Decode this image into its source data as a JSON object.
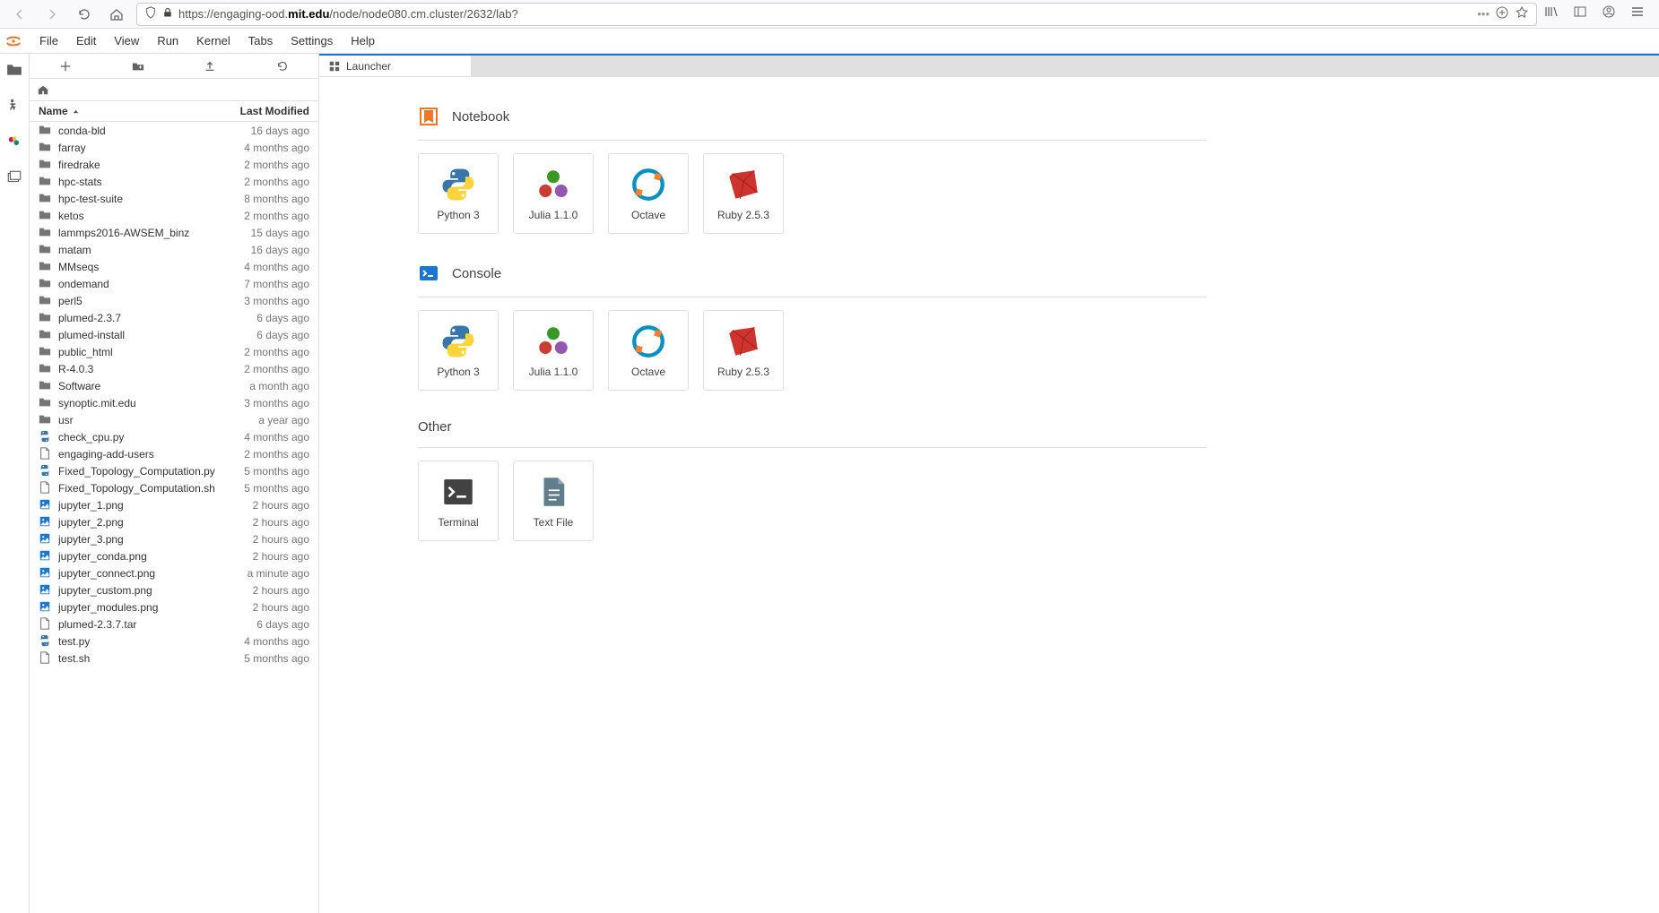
{
  "browser": {
    "url_prefix": "https://engaging-ood.",
    "url_domain": "mit.edu",
    "url_suffix": "/node/node080.cm.cluster/2632/lab?"
  },
  "menubar": [
    "File",
    "Edit",
    "View",
    "Run",
    "Kernel",
    "Tabs",
    "Settings",
    "Help"
  ],
  "filebrowser": {
    "header_name": "Name",
    "header_modified": "Last Modified",
    "files": [
      {
        "name": "conda-bld",
        "type": "folder",
        "modified": "16 days ago"
      },
      {
        "name": "farray",
        "type": "folder",
        "modified": "4 months ago"
      },
      {
        "name": "firedrake",
        "type": "folder",
        "modified": "2 months ago"
      },
      {
        "name": "hpc-stats",
        "type": "folder",
        "modified": "2 months ago"
      },
      {
        "name": "hpc-test-suite",
        "type": "folder",
        "modified": "8 months ago"
      },
      {
        "name": "ketos",
        "type": "folder",
        "modified": "2 months ago"
      },
      {
        "name": "lammps2016-AWSEM_binz",
        "type": "folder",
        "modified": "15 days ago"
      },
      {
        "name": "matam",
        "type": "folder",
        "modified": "16 days ago"
      },
      {
        "name": "MMseqs",
        "type": "folder",
        "modified": "4 months ago"
      },
      {
        "name": "ondemand",
        "type": "folder",
        "modified": "7 months ago"
      },
      {
        "name": "perl5",
        "type": "folder",
        "modified": "3 months ago"
      },
      {
        "name": "plumed-2.3.7",
        "type": "folder",
        "modified": "6 days ago"
      },
      {
        "name": "plumed-install",
        "type": "folder",
        "modified": "6 days ago"
      },
      {
        "name": "public_html",
        "type": "folder",
        "modified": "2 months ago"
      },
      {
        "name": "R-4.0.3",
        "type": "folder",
        "modified": "2 months ago"
      },
      {
        "name": "Software",
        "type": "folder",
        "modified": "a month ago"
      },
      {
        "name": "synoptic.mit.edu",
        "type": "folder",
        "modified": "3 months ago"
      },
      {
        "name": "usr",
        "type": "folder",
        "modified": "a year ago"
      },
      {
        "name": "check_cpu.py",
        "type": "python",
        "modified": "4 months ago"
      },
      {
        "name": "engaging-add-users",
        "type": "text",
        "modified": "2 months ago"
      },
      {
        "name": "Fixed_Topology_Computation.py",
        "type": "python",
        "modified": "5 months ago"
      },
      {
        "name": "Fixed_Topology_Computation.sh",
        "type": "text",
        "modified": "5 months ago"
      },
      {
        "name": "jupyter_1.png",
        "type": "image",
        "modified": "2 hours ago"
      },
      {
        "name": "jupyter_2.png",
        "type": "image",
        "modified": "2 hours ago"
      },
      {
        "name": "jupyter_3.png",
        "type": "image",
        "modified": "2 hours ago"
      },
      {
        "name": "jupyter_conda.png",
        "type": "image",
        "modified": "2 hours ago"
      },
      {
        "name": "jupyter_connect.png",
        "type": "image",
        "modified": "a minute ago"
      },
      {
        "name": "jupyter_custom.png",
        "type": "image",
        "modified": "2 hours ago"
      },
      {
        "name": "jupyter_modules.png",
        "type": "image",
        "modified": "2 hours ago"
      },
      {
        "name": "plumed-2.3.7.tar",
        "type": "text",
        "modified": "6 days ago"
      },
      {
        "name": "test.py",
        "type": "python",
        "modified": "4 months ago"
      },
      {
        "name": "test.sh",
        "type": "text",
        "modified": "5 months ago"
      }
    ]
  },
  "tab": {
    "label": "Launcher"
  },
  "launcher": {
    "sections": [
      {
        "title": "Notebook",
        "icon": "notebook",
        "cards": [
          {
            "label": "Python 3",
            "icon": "python"
          },
          {
            "label": "Julia 1.1.0",
            "icon": "julia"
          },
          {
            "label": "Octave",
            "icon": "octave"
          },
          {
            "label": "Ruby 2.5.3",
            "icon": "ruby"
          }
        ]
      },
      {
        "title": "Console",
        "icon": "console",
        "cards": [
          {
            "label": "Python 3",
            "icon": "python"
          },
          {
            "label": "Julia 1.1.0",
            "icon": "julia"
          },
          {
            "label": "Octave",
            "icon": "octave"
          },
          {
            "label": "Ruby 2.5.3",
            "icon": "ruby"
          }
        ]
      },
      {
        "title": "Other",
        "icon": "none",
        "cards": [
          {
            "label": "Terminal",
            "icon": "terminal"
          },
          {
            "label": "Text File",
            "icon": "textfile"
          }
        ]
      }
    ]
  }
}
